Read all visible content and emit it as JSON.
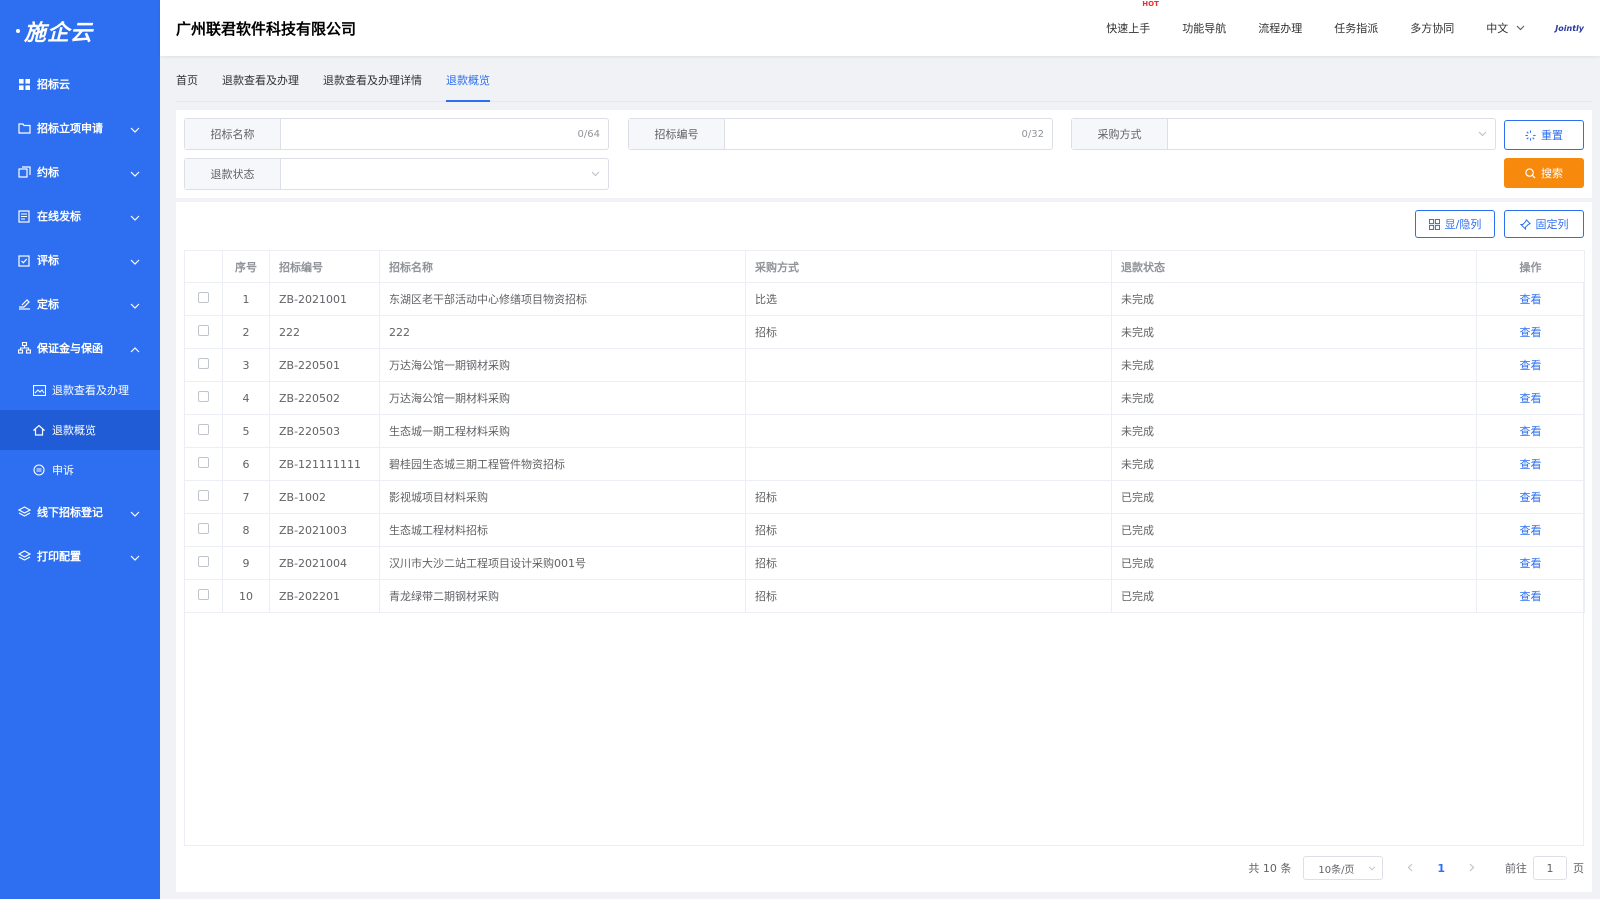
{
  "sidebar": {
    "logo": "施企云",
    "items": [
      {
        "label": "招标云",
        "icon": "grid-icon",
        "expandable": false
      },
      {
        "label": "招标立项申请",
        "icon": "folder-icon",
        "expandable": true
      },
      {
        "label": "约标",
        "icon": "document-stack-icon",
        "expandable": true
      },
      {
        "label": "在线发标",
        "icon": "document-list-icon",
        "expandable": true
      },
      {
        "label": "评标",
        "icon": "clipboard-check-icon",
        "expandable": true
      },
      {
        "label": "定标",
        "icon": "hand-pen-icon",
        "expandable": true
      },
      {
        "label": "保证金与保函",
        "icon": "org-tree-icon",
        "expandable": true,
        "expanded": true
      }
    ],
    "subitems": [
      {
        "label": "退款查看及办理",
        "icon": "image-card-icon"
      },
      {
        "label": "退款概览",
        "icon": "home-icon",
        "active": true
      },
      {
        "label": "申诉",
        "icon": "appeal-circle-icon"
      }
    ],
    "items_after": [
      {
        "label": "线下招标登记",
        "icon": "layers-icon",
        "expandable": true
      },
      {
        "label": "打印配置",
        "icon": "layers-icon",
        "expandable": true
      }
    ]
  },
  "header": {
    "company": "广州联君软件科技有限公司",
    "nav": [
      "快速上手",
      "功能导航",
      "流程办理",
      "任务指派",
      "多方协同"
    ],
    "hot_badge": "HOT",
    "language": "中文",
    "brand": "Jointly"
  },
  "tabs": [
    {
      "label": "首页",
      "active": false
    },
    {
      "label": "退款查看及办理",
      "active": false
    },
    {
      "label": "退款查看及办理详情",
      "active": false
    },
    {
      "label": "退款概览",
      "active": true
    }
  ],
  "filters": {
    "bid_name": {
      "label": "招标名称",
      "value": "",
      "counter": "0/64"
    },
    "bid_no": {
      "label": "招标编号",
      "value": "",
      "counter": "0/32"
    },
    "purchase_method": {
      "label": "采购方式",
      "value": ""
    },
    "refund_status": {
      "label": "退款状态",
      "value": ""
    },
    "reset_label": "重置",
    "search_label": "搜索"
  },
  "toolbar": {
    "toggle_cols_label": "显/隐列",
    "fix_cols_label": "固定列"
  },
  "table": {
    "headers": [
      "序号",
      "招标编号",
      "招标名称",
      "采购方式",
      "退款状态",
      "操作"
    ],
    "action_label": "查看",
    "rows": [
      {
        "no": "1",
        "code": "ZB-2021001",
        "name": "东湖区老干部活动中心修缮项目物资招标",
        "method": "比选",
        "status": "未完成"
      },
      {
        "no": "2",
        "code": "222",
        "name": "222",
        "method": "招标",
        "status": "未完成"
      },
      {
        "no": "3",
        "code": "ZB-220501",
        "name": "万达海公馆一期钢材采购",
        "method": "",
        "status": "未完成"
      },
      {
        "no": "4",
        "code": "ZB-220502",
        "name": "万达海公馆一期材料采购",
        "method": "",
        "status": "未完成"
      },
      {
        "no": "5",
        "code": "ZB-220503",
        "name": "生态城一期工程材料采购",
        "method": "",
        "status": "未完成"
      },
      {
        "no": "6",
        "code": "ZB-121111111",
        "name": "碧桂园生态城三期工程管件物资招标",
        "method": "",
        "status": "未完成"
      },
      {
        "no": "7",
        "code": "ZB-1002",
        "name": "影视城项目材料采购",
        "method": "招标",
        "status": "已完成"
      },
      {
        "no": "8",
        "code": "ZB-2021003",
        "name": "生态城工程材料招标",
        "method": "招标",
        "status": "已完成"
      },
      {
        "no": "9",
        "code": "ZB-2021004",
        "name": "汉川市大沙二站工程项目设计采购001号",
        "method": "招标",
        "status": "已完成"
      },
      {
        "no": "10",
        "code": "ZB-202201",
        "name": "青龙绿带二期钢材采购",
        "method": "招标",
        "status": "已完成"
      }
    ]
  },
  "pagination": {
    "total": "共 10 条",
    "page_size": "10条/页",
    "current_page": "1",
    "goto_prefix": "前往",
    "goto_value": "1",
    "goto_suffix": "页"
  },
  "colors": {
    "primary": "#2d6ff0",
    "sidebar_active": "#1f5cd6",
    "search_orange": "#f7890d"
  }
}
